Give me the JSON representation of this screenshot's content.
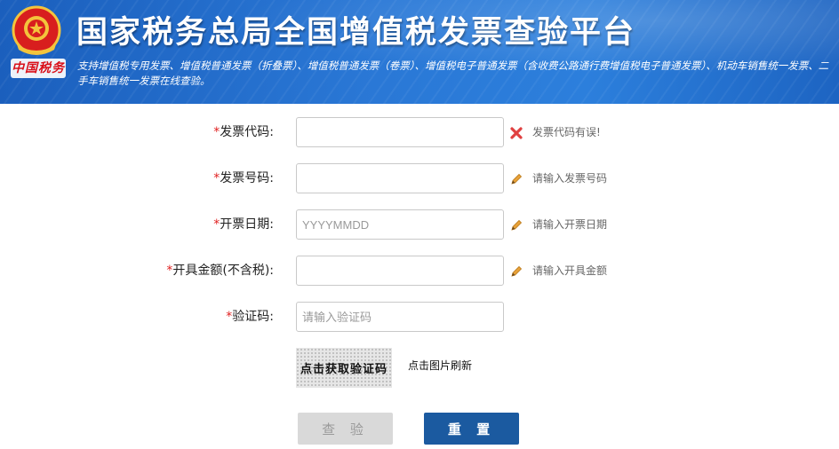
{
  "banner": {
    "title": "国家税务总局全国增值税发票查验平台",
    "subtitle": "支持增值税专用发票、增值税普通发票（折叠票）、增值税普通发票（卷票）、增值税电子普通发票（含收费公路通行费增值税电子普通发票）、机动车销售统一发票、二手车销售统一发票在线查验。",
    "seal_text": "中国税务"
  },
  "form": {
    "required_mark": "*",
    "invoice_code": {
      "label": "发票代码:",
      "value": "",
      "hint": "发票代码有误!",
      "hint_icon": "error-x-icon"
    },
    "invoice_number": {
      "label": "发票号码:",
      "value": "",
      "hint": "请输入发票号码",
      "hint_icon": "pencil-icon"
    },
    "invoice_date": {
      "label": "开票日期:",
      "placeholder": "YYYYMMDD",
      "hint": "请输入开票日期",
      "hint_icon": "pencil-icon"
    },
    "amount": {
      "label": "开具金额(不含税):",
      "value": "",
      "hint": "请输入开具金额",
      "hint_icon": "pencil-icon"
    },
    "captcha": {
      "label": "验证码:",
      "placeholder": "请输入验证码"
    },
    "captcha_image_text": "点击获取验证码",
    "captcha_refresh": "点击图片刷新",
    "check_button": "查 验",
    "reset_button": "重 置"
  },
  "colors": {
    "banner_blue": "#2a78d6",
    "required_red": "#e02020",
    "error_red": "#e04040",
    "pencil_orange": "#e8a23a",
    "reset_button": "#1b5aa0",
    "check_button_disabled": "#d9d9d9"
  }
}
